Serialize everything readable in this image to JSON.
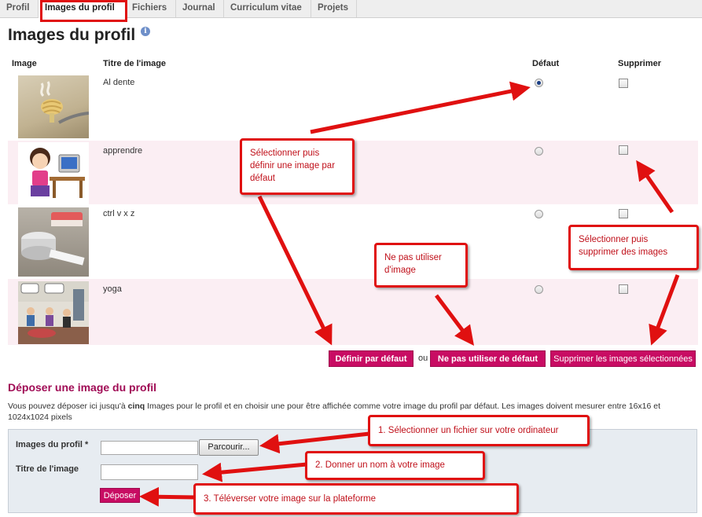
{
  "tabs": [
    "Profil",
    "Images du profil",
    "Fichiers",
    "Journal",
    "Curriculum vitae",
    "Projets"
  ],
  "page_title": "Images du profil",
  "info_icon": "i",
  "table": {
    "headers": {
      "image": "Image",
      "title": "Titre de l'image",
      "default": "Défaut",
      "delete": "Supprimer"
    },
    "rows": [
      {
        "title": "Al dente",
        "default_selected": true
      },
      {
        "title": "apprendre",
        "default_selected": false
      },
      {
        "title": "ctrl v x z",
        "default_selected": false
      },
      {
        "title": "yoga",
        "default_selected": false
      }
    ]
  },
  "actions": {
    "set_default": "Définir par défaut",
    "or": "ou",
    "no_default": "Ne pas utiliser de défaut",
    "delete_selected": "Supprimer les images sélectionnées"
  },
  "upload": {
    "heading": "Déposer une image du profil",
    "description_before": "Vous pouvez déposer ici jusqu'à ",
    "description_bold": "cinq",
    "description_after": " Images pour le profil et en choisir une pour être affichée comme votre image du profil par défaut. Les images doivent mesurer entre 16x16 et 1024x1024 pixels",
    "file_label": "Images du profil",
    "required_mark": "*",
    "browse": "Parcourir...",
    "title_label": "Titre de l'image",
    "submit": "Déposer"
  },
  "callouts": {
    "select_default": "Sélectionner puis définir une image par défaut",
    "no_image": "Ne pas utiliser d'image",
    "select_delete": "Sélectionner puis supprimer des images",
    "step1": "1. Sélectionner un fichier sur votre ordinateur",
    "step2": "2. Donner un nom à votre image",
    "step3": "3. Téléverser votre image sur la plateforme"
  },
  "colors": {
    "accent": "#c80c63",
    "heading": "#a00b55",
    "callout_border": "#e01010",
    "row_alt": "#fbeef3"
  }
}
